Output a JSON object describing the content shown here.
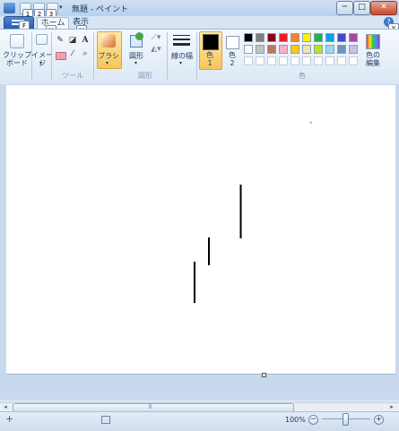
{
  "window": {
    "title": "無題 - ペイント",
    "minimize_glyph": "─",
    "maximize_glyph": "□",
    "close_glyph": "✕"
  },
  "quick_access": {
    "keytips": [
      "1",
      "2",
      "3"
    ]
  },
  "tabs": {
    "file_keytip": "F",
    "home_label": "ホーム",
    "home_keytip": "H",
    "view_label": "表示",
    "view_keytip": "V",
    "help_keytip": "Y"
  },
  "ribbon": {
    "clipboard_label": "クリップ\nボード",
    "image_label": "イメージ",
    "tools_group_label": "ツール",
    "brush_label": "ブラシ",
    "shapes_label": "図形",
    "shapes_group_label": "図形",
    "size_label": "線の幅",
    "color1_label": "色\n1",
    "color2_label": "色\n2",
    "colors_group_label": "色",
    "edit_colors_label": "色の\n編集",
    "text_tool_glyph": "A"
  },
  "colors": {
    "color1": "#000000",
    "color2": "#ffffff",
    "palette_row1": [
      "#000000",
      "#7f7f7f",
      "#880015",
      "#ed1c24",
      "#ff7f27",
      "#fff200",
      "#22b14c",
      "#00a2e8",
      "#3f48cc",
      "#a349a4"
    ],
    "palette_row2": [
      "#ffffff",
      "#c3c3c3",
      "#b97a57",
      "#ffaec9",
      "#ffc90e",
      "#efe4b0",
      "#b5e61d",
      "#99d9ea",
      "#7092be",
      "#c8bfe7"
    ],
    "palette_row3_empty_count": 10,
    "accent": "#2a5ea8"
  },
  "statusbar": {
    "zoom": "100%",
    "zoom_out_glyph": "−",
    "zoom_in_glyph": "+",
    "add_glyph": "+"
  },
  "scrollbar": {
    "left_arrow": "◂",
    "right_arrow": "▸",
    "thumb_grip": "⦀"
  }
}
